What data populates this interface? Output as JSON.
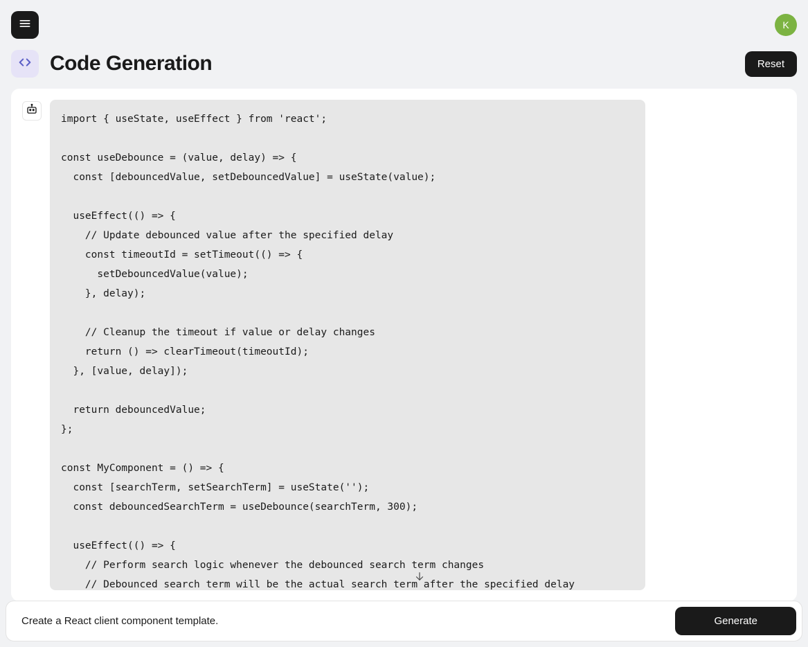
{
  "header": {
    "title": "Code Generation",
    "reset_label": "Reset"
  },
  "avatar": {
    "initial": "K"
  },
  "code": "import { useState, useEffect } from 'react';\n\nconst useDebounce = (value, delay) => {\n  const [debouncedValue, setDebouncedValue] = useState(value);\n\n  useEffect(() => {\n    // Update debounced value after the specified delay\n    const timeoutId = setTimeout(() => {\n      setDebouncedValue(value);\n    }, delay);\n\n    // Cleanup the timeout if value or delay changes\n    return () => clearTimeout(timeoutId);\n  }, [value, delay]);\n\n  return debouncedValue;\n};\n\nconst MyComponent = () => {\n  const [searchTerm, setSearchTerm] = useState('');\n  const debouncedSearchTerm = useDebounce(searchTerm, 300);\n\n  useEffect(() => {\n    // Perform search logic whenever the debounced search term changes\n    // Debounced search term will be the actual search term after the specified delay\n    if (debouncedSearchTerm) {",
  "input": {
    "value": "Create a React client component template.",
    "generate_label": "Generate"
  }
}
